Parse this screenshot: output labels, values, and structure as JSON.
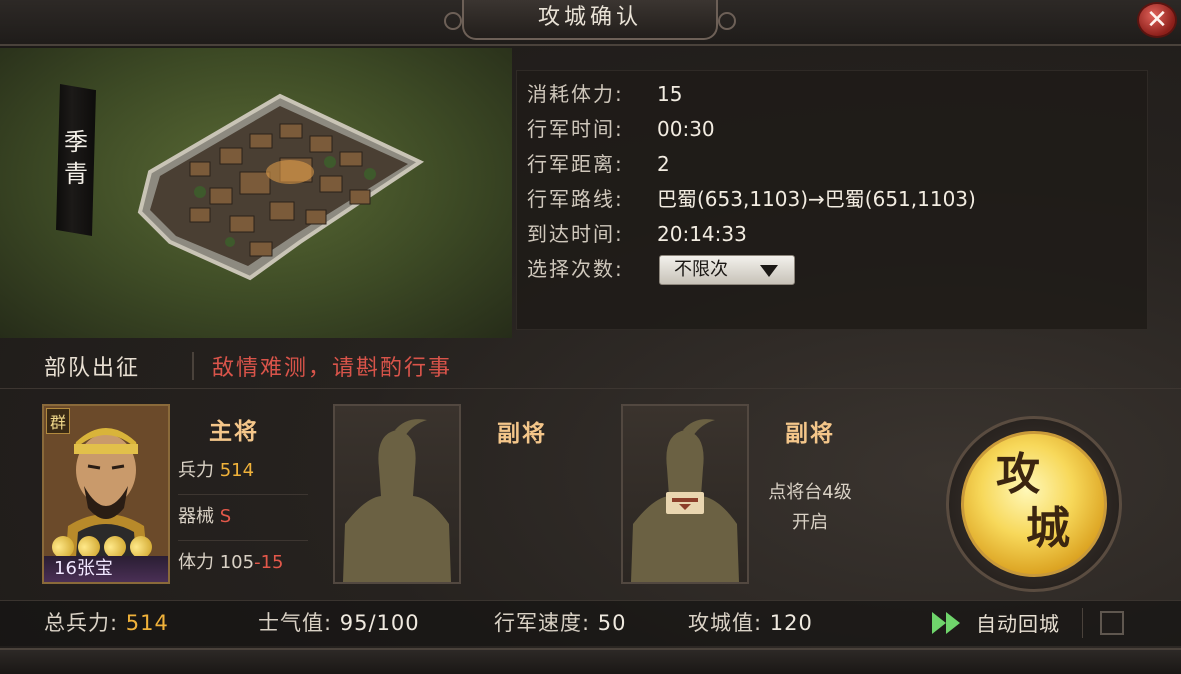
{
  "header": {
    "title": "攻城确认",
    "close_label": "✕"
  },
  "city": {
    "name_chars": [
      "季",
      "青"
    ]
  },
  "info": {
    "rows": [
      {
        "label": "消耗体力:",
        "value": "15"
      },
      {
        "label": "行军时间:",
        "value": "00:30"
      },
      {
        "label": "行军距离:",
        "value": "2"
      },
      {
        "label": "行军路线:",
        "value": "巴蜀(653,1103)→巴蜀(651,1103)"
      },
      {
        "label": "到达时间:",
        "value": "20:14:33"
      },
      {
        "label": "选择次数:",
        "value": ""
      }
    ],
    "select_value": "不限次"
  },
  "troops": {
    "section_label": "部队出征",
    "warning": "敌情难测，请斟酌行事"
  },
  "main_general": {
    "role": "主将",
    "faction": "群",
    "name": "16张宝",
    "stars": 4,
    "soldiers_label": "兵力",
    "soldiers_value": "514",
    "equipment_label": "器械",
    "equipment_value": "S",
    "stamina_label": "体力",
    "stamina_value": "105",
    "stamina_cost": "-15"
  },
  "vice_generals": [
    {
      "role": "副将",
      "lock_text": ""
    },
    {
      "role": "副将",
      "lock_text_line1": "点将台4级",
      "lock_text_line2": "开启"
    }
  ],
  "attack_button": {
    "char1": "攻",
    "char2": "城"
  },
  "footer": {
    "total_troops_label": "总兵力:",
    "total_troops_value": "514",
    "morale_label": "士气值:",
    "morale_value": "95/100",
    "speed_label": "行军速度:",
    "speed_value": "50",
    "siege_label": "攻城值:",
    "siege_value": "120",
    "auto_return_label": "自动回城",
    "auto_return_checked": false
  }
}
